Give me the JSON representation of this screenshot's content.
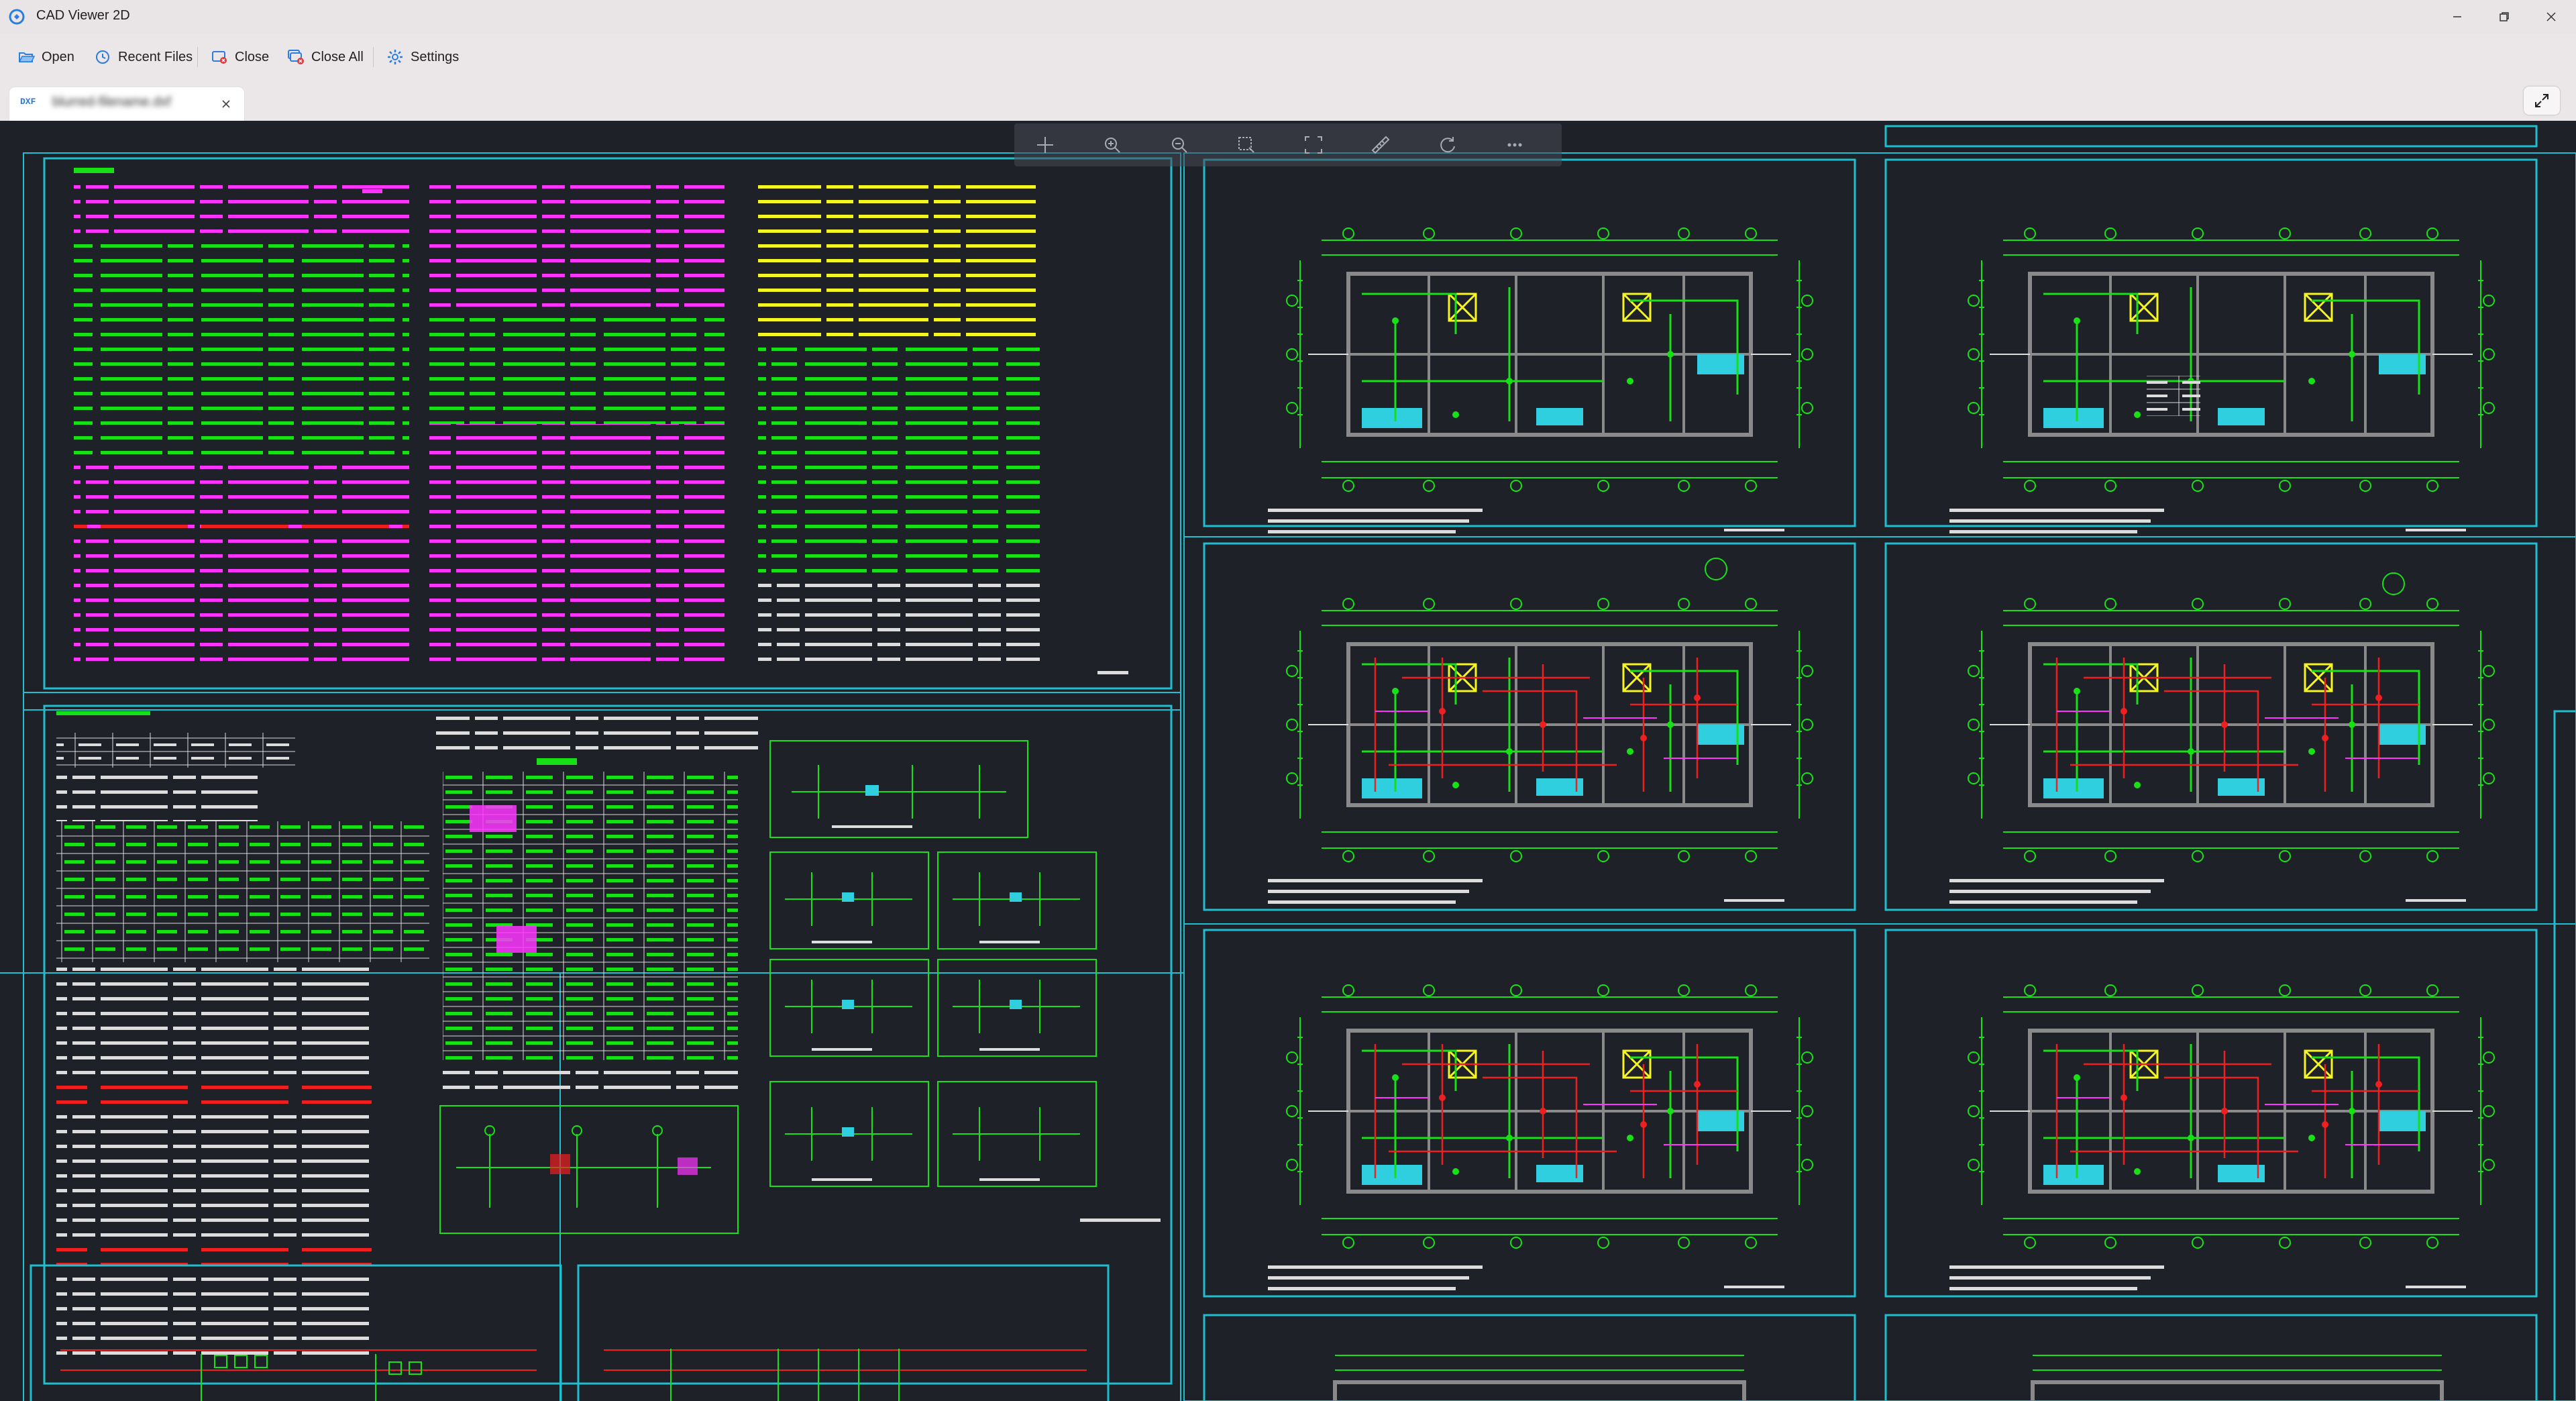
{
  "window": {
    "title": "CAD Viewer 2D",
    "icon": "cad-app-icon",
    "controls": [
      "minimize-icon",
      "restore-icon",
      "close-icon"
    ]
  },
  "toolbar": {
    "open": "Open",
    "recent_files": "Recent Files",
    "close": "Close",
    "close_all": "Close All",
    "settings": "Settings"
  },
  "tabs": [
    {
      "badge": "DXF",
      "label": "blurred-filename.dxf",
      "close_icon": "close-icon"
    }
  ],
  "viewer": {
    "expand_icon": "expand-icon",
    "floating_toolbar_icons": [
      "pan-icon",
      "zoom-in-icon",
      "zoom-out-icon",
      "zoom-window-icon",
      "fit-icon",
      "measure-icon",
      "rotate-icon",
      "more-icon"
    ]
  },
  "colors": {
    "canvas": "#1f2128",
    "frame": "#1fbfcf",
    "cad_green": "#17e017",
    "cad_red": "#ef1f1f",
    "cad_magenta": "#ff35ff",
    "cad_yellow": "#f5f523",
    "cad_cyan": "#20dfef",
    "cad_white": "#e8e8e8",
    "wall_gray": "#8a8a8a"
  }
}
